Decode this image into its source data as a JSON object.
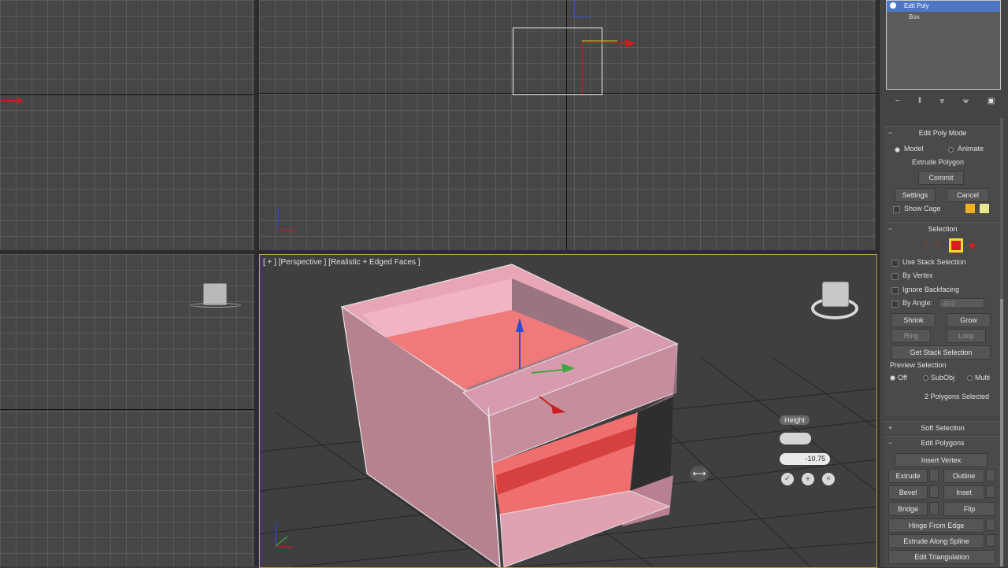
{
  "viewports": {
    "perspective_label": "[ + ] [Perspective ] [Realistic + Edged Faces ]"
  },
  "modifier_stack": {
    "items": [
      {
        "label": "Edit Poly",
        "selected": true
      },
      {
        "label": "Box",
        "selected": false
      }
    ]
  },
  "stack_toolbar": {
    "icons": [
      "pin-stack-icon",
      "show-end-result-icon",
      "make-unique-icon",
      "remove-modifier-icon",
      "configure-sets-icon"
    ],
    "glyphs": [
      "−",
      "‖",
      "⩔",
      "⩖",
      "▣"
    ]
  },
  "edit_poly_mode": {
    "title": "Edit Poly Mode",
    "model_label": "Model",
    "animate_label": "Animate",
    "operation_label": "Extrude Polygon",
    "commit_label": "Commit",
    "settings_label": "Settings",
    "cancel_label": "Cancel",
    "show_cage_label": "Show Cage",
    "cage_colors": [
      "#f0b020",
      "#e8e890"
    ]
  },
  "selection": {
    "title": "Selection",
    "use_stack_label": "Use Stack Selection",
    "by_vertex_label": "By Vertex",
    "ignore_backfacing_label": "Ignore Backfacing",
    "by_angle_label": "By Angle:",
    "by_angle_value": "45.0",
    "shrink_label": "Shrink",
    "grow_label": "Grow",
    "ring_label": "Ring",
    "loop_label": "Loop",
    "get_stack_label": "Get Stack Selection",
    "preview_label": "Preview Selection",
    "preview_off": "Off",
    "preview_subobj": "SubObj",
    "preview_multi": "Multi",
    "status_text": "2 Polygons Selected"
  },
  "soft_selection": {
    "title": "Soft Selection"
  },
  "edit_polygons": {
    "title": "Edit Polygons",
    "insert_vertex": "Insert Vertex",
    "extrude": "Extrude",
    "outline": "Outline",
    "bevel": "Bevel",
    "inset": "Inset",
    "bridge": "Bridge",
    "flip": "Flip",
    "hinge": "Hinge From Edge",
    "extrude_spline": "Extrude Along Spline",
    "edit_triangulation": "Edit Triangulation"
  },
  "caddy": {
    "height_label": "Height",
    "height_value": "-10.75"
  },
  "viewcube": {
    "label": "ViewCube"
  }
}
